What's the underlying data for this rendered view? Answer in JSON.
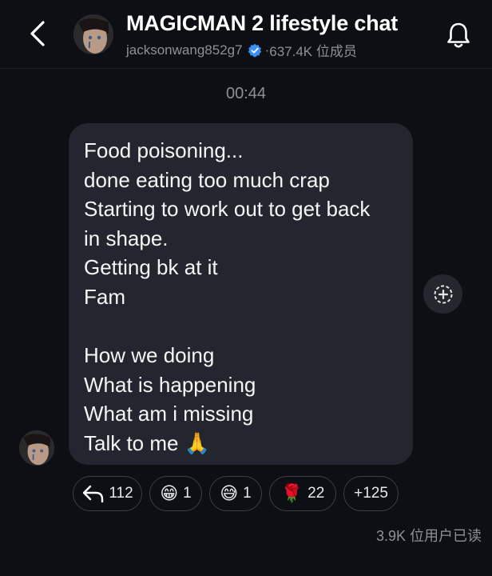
{
  "header": {
    "title": "MAGICMAN 2 lifestyle chat",
    "username": "jacksonwang852g7",
    "separator": "·",
    "members": "637.4K 位成员"
  },
  "icons": {
    "back": "chevron-left-icon",
    "verified": "verified-badge-icon",
    "bell": "bell-icon",
    "add_reaction": "add-reaction-icon",
    "reply": "reply-arrow-icon"
  },
  "colors": {
    "background": "#0d0f14",
    "bubble": "#23262e",
    "verified": "#3b91f7"
  },
  "timestamp": "00:44",
  "message": {
    "lines": [
      "Food poisoning...",
      "done eating too much crap",
      "Starting to work out to get back",
      "in shape.",
      "Getting bk at it",
      "Fam",
      "",
      "How we doing",
      "What is happening",
      "What am i missing",
      "Talk to me 🙏"
    ]
  },
  "reactions": [
    {
      "emoji": "",
      "count": "112"
    },
    {
      "emoji": "😁",
      "count": "1"
    },
    {
      "emoji": "😅",
      "count": "1"
    },
    {
      "emoji": "🌹",
      "count": "22"
    },
    {
      "emoji": "",
      "count": "+125"
    }
  ],
  "seen_by": "3.9K 位用户已读"
}
